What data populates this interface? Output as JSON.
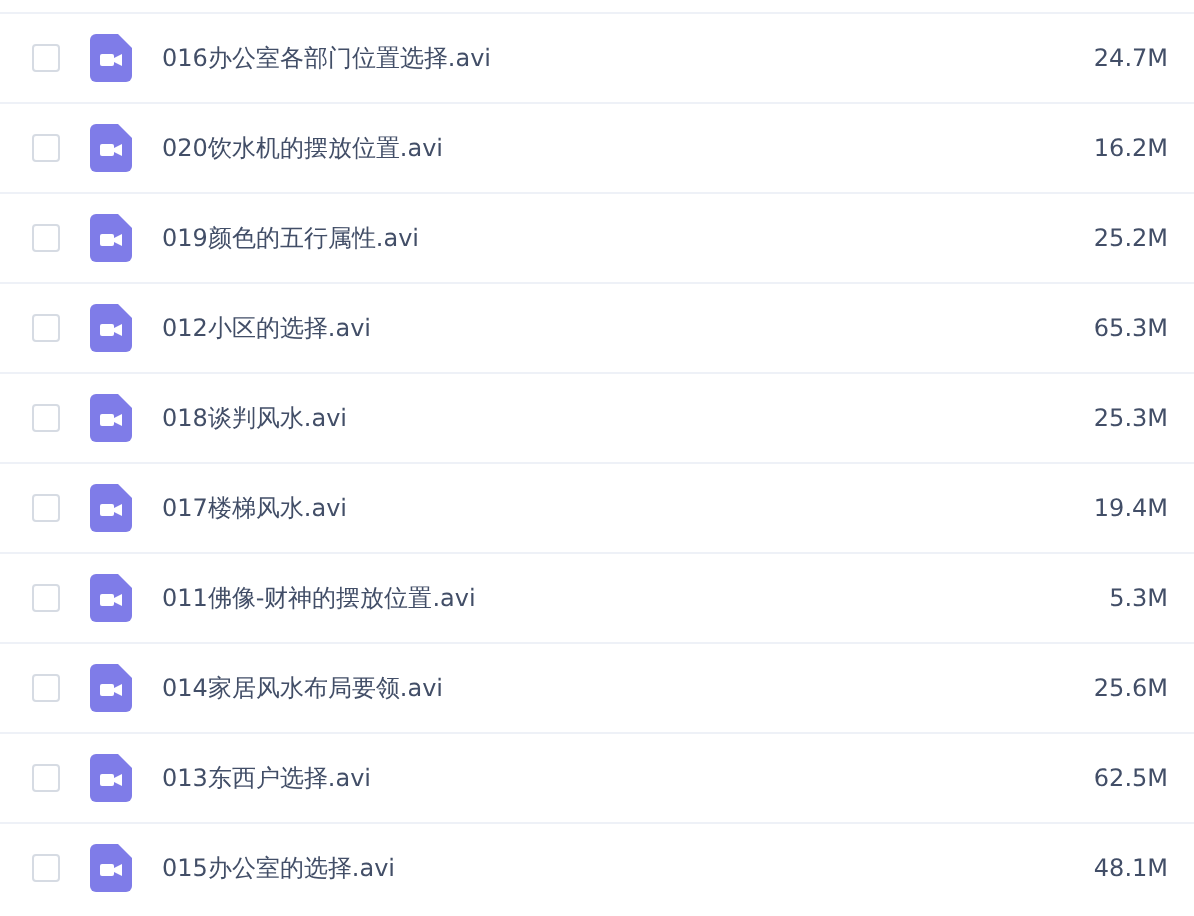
{
  "files": [
    {
      "name": "016办公室各部门位置选择.avi",
      "size": "24.7M",
      "checked": false
    },
    {
      "name": "020饮水机的摆放位置.avi",
      "size": "16.2M",
      "checked": false
    },
    {
      "name": "019颜色的五行属性.avi",
      "size": "25.2M",
      "checked": false
    },
    {
      "name": "012小区的选择.avi",
      "size": "65.3M",
      "checked": false
    },
    {
      "name": "018谈判风水.avi",
      "size": "25.3M",
      "checked": false
    },
    {
      "name": "017楼梯风水.avi",
      "size": "19.4M",
      "checked": false
    },
    {
      "name": "011佛像-财神的摆放位置.avi",
      "size": "5.3M",
      "checked": false
    },
    {
      "name": "014家居风水布局要领.avi",
      "size": "25.6M",
      "checked": false
    },
    {
      "name": "013东西户选择.avi",
      "size": "62.5M",
      "checked": false
    },
    {
      "name": "015办公室的选择.avi",
      "size": "48.1M",
      "checked": false
    }
  ]
}
